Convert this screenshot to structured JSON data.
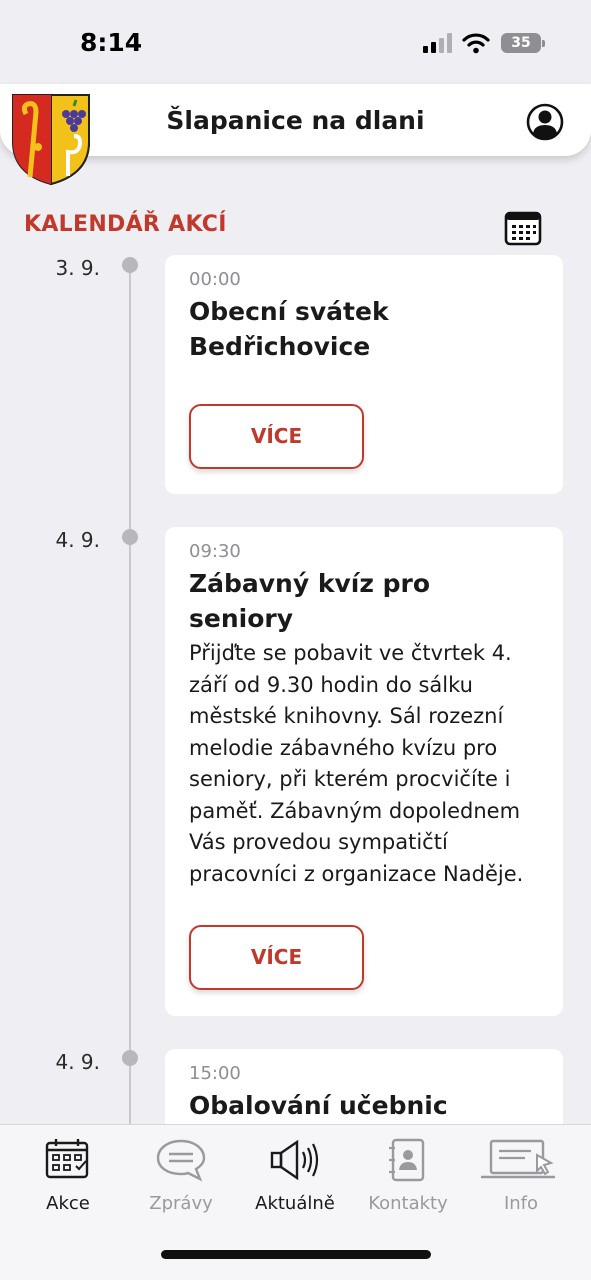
{
  "status_bar": {
    "time": "8:14",
    "battery": "35"
  },
  "header": {
    "title": "Šlapanice na dlani"
  },
  "section": {
    "title": "KALENDÁŘ AKCÍ"
  },
  "events": [
    {
      "date": "3. 9.",
      "time": "00:00",
      "title": "Obecní svátek Bedřichovice",
      "description": "",
      "button": "VÍCE"
    },
    {
      "date": "4. 9.",
      "time": "09:30",
      "title": "Zábavný kvíz pro seniory",
      "description": "Přijďte se pobavit ve čtvrtek 4. září od 9.30 hodin do sálku městské knihovny. Sál rozezní melodie zábavného kvízu pro seniory, při kterém procvičíte i paměť. Zábavným dopolednem Vás provedou sympatičtí pracovníci z organizace Naděje.",
      "button": "VÍCE"
    },
    {
      "date": "4. 9.",
      "time": "15:00",
      "title": "Obalování učebnic"
    }
  ],
  "tabs": [
    {
      "label": "Akce",
      "icon": "calendar-grid-icon",
      "active": true
    },
    {
      "label": "Zprávy",
      "icon": "chat-bubble-icon",
      "active": false
    },
    {
      "label": "Aktuálně",
      "icon": "megaphone-icon",
      "active": false
    },
    {
      "label": "Kontakty",
      "icon": "contact-book-icon",
      "active": false
    },
    {
      "label": "Info",
      "icon": "laptop-cursor-icon",
      "active": false
    }
  ],
  "colors": {
    "accent": "#c0392b",
    "background": "#efeef2"
  }
}
